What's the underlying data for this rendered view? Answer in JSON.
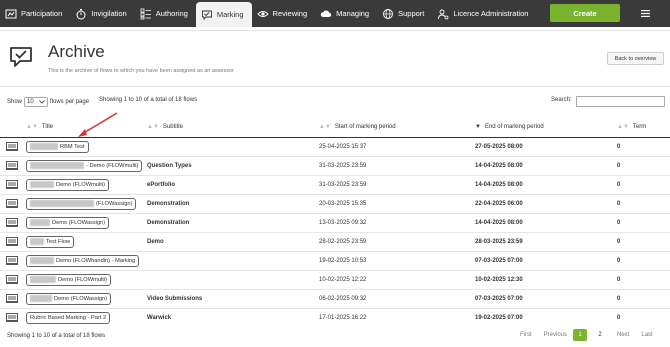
{
  "nav": {
    "items": [
      {
        "label": "Participation",
        "icon": "participation-icon"
      },
      {
        "label": "Invigilation",
        "icon": "stopwatch-icon"
      },
      {
        "label": "Authoring",
        "icon": "checklist-icon"
      },
      {
        "label": "Marking",
        "icon": "speech-check-icon",
        "active": true
      },
      {
        "label": "Reviewing",
        "icon": "review-eye-icon"
      },
      {
        "label": "Managing",
        "icon": "cloud-upload-icon"
      },
      {
        "label": "Support",
        "icon": "globe-icon"
      },
      {
        "label": "Licence Administration",
        "icon": "person-gear-icon"
      }
    ],
    "create_label": "Create",
    "menu_icon": "hamburger-icon"
  },
  "header": {
    "title": "Archive",
    "subtitle": "This is the archive of flows to which you have been assigned as an assessor",
    "back_label": "Back to overview"
  },
  "controls": {
    "show_label": "Show",
    "page_size": "10",
    "per_page_label": "flows per page",
    "info_top": "Showing 1 to 10 of a total of 18 flows",
    "search_label": "Search:"
  },
  "table": {
    "columns": [
      "Title",
      "Subtitle",
      "Start of marking period",
      "End of marking period",
      "Term"
    ],
    "rows": [
      {
        "title": "RBM Test",
        "subtitle": "",
        "start": "25-04-2025 15:37",
        "end": "27-05-2025 08:00",
        "term": "0"
      },
      {
        "title": "- Demo (FLOWmulti)",
        "subtitle": "Question Types",
        "start": "31-03-2025 23:59",
        "end": "14-04-2025 08:00",
        "term": "0"
      },
      {
        "title": "Demo (FLOWmulti)",
        "subtitle": "ePortfolio",
        "start": "31-03-2025 23:59",
        "end": "14-04-2025 08:00",
        "term": "0"
      },
      {
        "title": "(FLOWassign)",
        "subtitle": "Demonstration",
        "start": "20-03-2025 15:35",
        "end": "22-04-2025 06:00",
        "term": "0"
      },
      {
        "title": "Demo (FLOWassign)",
        "subtitle": "Demonstration",
        "start": "13-03-2025 09:32",
        "end": "14-04-2025 08:00",
        "term": "0"
      },
      {
        "title": "Test Flow",
        "subtitle": "Demo",
        "start": "28-02-2025 23:59",
        "end": "28-03-2025 23:59",
        "term": "0"
      },
      {
        "title": "Demo (FLOWhandin) - Marking",
        "subtitle": "",
        "start": "19-02-2025 10:53",
        "end": "07-03-2025 07:00",
        "term": "0"
      },
      {
        "title": "Demo (FLOWmulti)",
        "subtitle": "",
        "start": "10-02-2025 12:22",
        "end": "10-02-2025 12:30",
        "term": "0"
      },
      {
        "title": "Demo (FLOWassign)",
        "subtitle": "Video Submissions",
        "start": "06-02-2025 09:32",
        "end": "07-03-2025 07:00",
        "term": "0"
      },
      {
        "title": "Rubric Based Marking - Part 2",
        "subtitle": "Warwick",
        "start": "17-01-2025 16:22",
        "end": "19-02-2025 07:00",
        "term": "0"
      }
    ]
  },
  "footer": {
    "info": "Showing 1 to 10 of a total of 18 flows",
    "first": "First",
    "previous": "Previous",
    "page1": "1",
    "page2": "2",
    "next": "Next",
    "last": "Last"
  },
  "colors": {
    "accent": "#7ab32e",
    "nav_bg": "#3a3a3a",
    "annotation_arrow": "#e03131"
  }
}
